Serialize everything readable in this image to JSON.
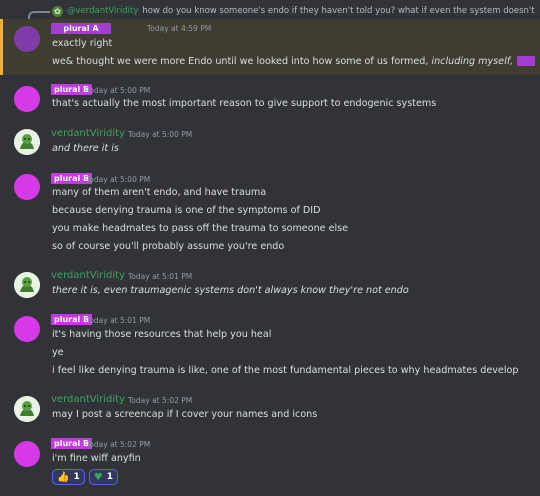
{
  "reply": {
    "username": "@verdantViridity",
    "text": "how do you know someone's endo if they haven't told you? what if even the system doesn't know?"
  },
  "messages": [
    {
      "author": "plural A",
      "timestamp": "Today at 4:59 PM",
      "lines": [
        "exactly right",
        "we& thought we were more Endo until we looked into how some of us formed, ",
        "including myself,"
      ]
    },
    {
      "author": "plural B",
      "timestamp": "Today at 5:00 PM",
      "lines": [
        "that's actually the most important reason to give support to endogenic systems"
      ]
    },
    {
      "author": "verdantViridity",
      "timestamp": "Today at 5:00 PM",
      "lines": [
        "and there it is"
      ]
    },
    {
      "author": "plural B",
      "timestamp": "Today at 5:00 PM",
      "lines": [
        "many of them aren't endo, and have trauma",
        "because denying trauma is one of the symptoms of DID",
        "you make headmates to pass off the trauma to someone else",
        "so of course you'll probably assume you're endo"
      ]
    },
    {
      "author": "verdantViridity",
      "timestamp": "Today at 5:01 PM",
      "lines": [
        "there it is, even traumagenic systems don't always know they're not endo"
      ]
    },
    {
      "author": "plural B",
      "timestamp": "Today at 5:01 PM",
      "lines": [
        "it's having those resources that help you heal",
        "ye",
        "i feel like denying trauma is like, one of the most fundamental pieces to why headmates develop"
      ]
    },
    {
      "author": "verdantViridity",
      "timestamp": "Today at 5:02 PM",
      "lines": [
        "may I post a screencap if I cover your names and icons"
      ]
    },
    {
      "author": "plural B",
      "timestamp": "Today at 5:02 PM",
      "lines": [
        "i'm fine wiff anyfin"
      ]
    }
  ],
  "reactions": [
    {
      "icon": "thumbs-up-icon",
      "glyph": "👍",
      "count": "1"
    },
    {
      "icon": "green-heart-icon",
      "glyph": "♥",
      "count": "1"
    }
  ]
}
